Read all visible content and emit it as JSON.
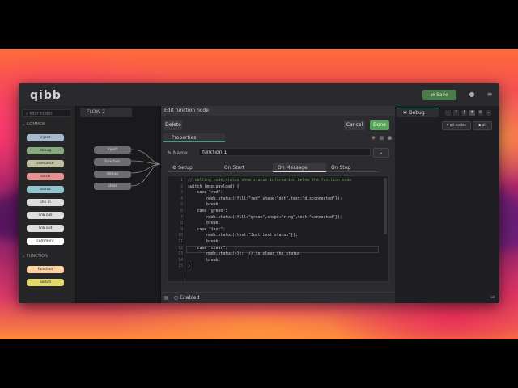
{
  "app": {
    "logo": "qibb"
  },
  "header": {
    "deploy_label": "Save"
  },
  "palette": {
    "filter_placeholder": "filter nodes",
    "categories": [
      "COMMON",
      "FUNCTION"
    ],
    "common_nodes": [
      {
        "label": "inject",
        "color": "#a6bbcf"
      },
      {
        "label": "debug",
        "color": "#87a980"
      },
      {
        "label": "complete",
        "color": "#c0c0a0"
      },
      {
        "label": "catch",
        "color": "#e49191"
      },
      {
        "label": "status",
        "color": "#94c1d0"
      },
      {
        "label": "link in",
        "color": "#dddddd"
      },
      {
        "label": "link call",
        "color": "#dddddd"
      },
      {
        "label": "link out",
        "color": "#dddddd"
      },
      {
        "label": "comment",
        "color": "#ffffff"
      }
    ],
    "function_nodes": [
      {
        "label": "function",
        "color": "#fdd0a2"
      },
      {
        "label": "switch",
        "color": "#e2d96e"
      }
    ]
  },
  "workspace": {
    "flow_tab": "FLOW 2",
    "nodes": [
      "inject",
      "function",
      "debug",
      "clear"
    ]
  },
  "tray": {
    "title": "Edit function node",
    "delete_label": "Delete",
    "cancel_label": "Cancel",
    "done_label": "Done",
    "properties_label": "Properties",
    "name_label": "Name",
    "name_value": "function 1",
    "tabs": [
      "Setup",
      "On Start",
      "On Message",
      "On Stop"
    ],
    "active_tab": "On Message",
    "code_lines": [
      "// calling node.status show status information below the function node",
      "switch (msg.payload) {",
      "    case \"red\":",
      "        node.status({fill:\"red\",shape:\"dot\",text:\"disconnected\"});",
      "        break;",
      "    case \"green\":",
      "        node.status({fill:\"green\",shape:\"ring\",text:\"connected\"});",
      "        break;",
      "    case \"text\":",
      "        node.status({text:\"Just text status\"});",
      "        break;",
      "    case \"clear\":",
      "        node.status({});  // to clear the status",
      "        break;",
      "}"
    ],
    "enabled_label": "Enabled"
  },
  "sidebar": {
    "tab_label": "Debug",
    "filter_label": "all nodes",
    "clear_label": "all"
  },
  "colors": {
    "accent": "#3aa876",
    "done": "#5aa35a"
  }
}
